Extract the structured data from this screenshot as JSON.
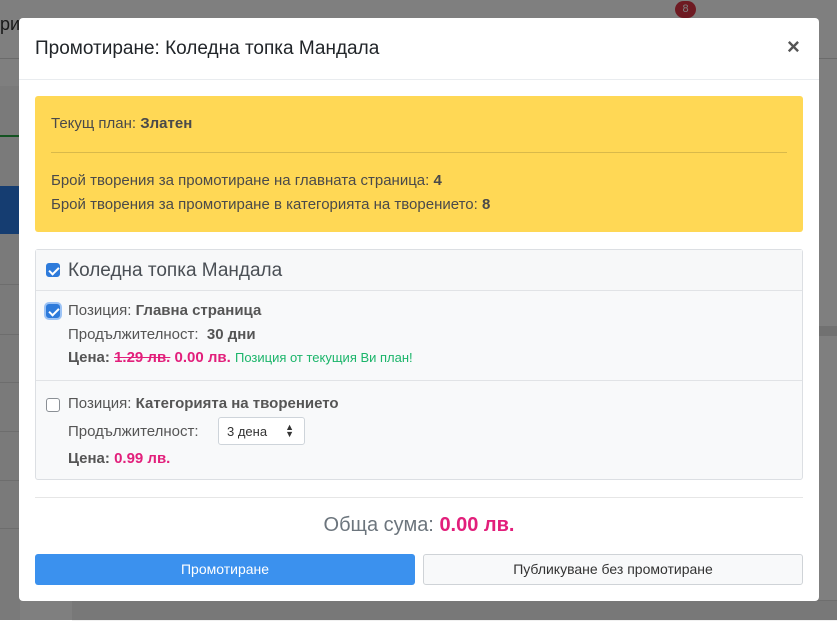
{
  "background": {
    "topbar_text": "ри",
    "badge_count": "8"
  },
  "modal": {
    "title": "Промотиране: Коледна топка Мандала",
    "close_label": "×",
    "alert": {
      "plan_label": "Текущ план:",
      "plan_value": "Златен",
      "home_label": "Брой творения за промотиране на главната страница:",
      "home_value": "4",
      "category_label": "Брой творения за промотиране в категорията на творението:",
      "category_value": "8"
    },
    "item": {
      "title": "Коледна топка Мандала",
      "checked": true,
      "options": [
        {
          "position_label": "Позиция:",
          "position_value": "Главна страница",
          "checked": true,
          "duration_label": "Продължителност:",
          "duration_value": "30 дни",
          "price_label": "Цена:",
          "price_old": "1.29 лв.",
          "price_new": "0.00 лв.",
          "note": "Позиция от текущия Ви план!"
        },
        {
          "position_label": "Позиция:",
          "position_value": "Категорията на творението",
          "checked": false,
          "duration_label": "Продължителност:",
          "duration_select": "3 дена",
          "price_label": "Цена:",
          "price_new": "0.99 лв."
        }
      ]
    },
    "total_label": "Обща сума:",
    "total_value": "0.00 лв.",
    "promote_button": "Промотиране",
    "publish_button": "Публикуване без промотиране"
  },
  "colors": {
    "alert_bg": "#ffd855",
    "accent_pink": "#e21f7b",
    "primary_blue": "#3b91ee",
    "success_green": "#1bb56a"
  }
}
